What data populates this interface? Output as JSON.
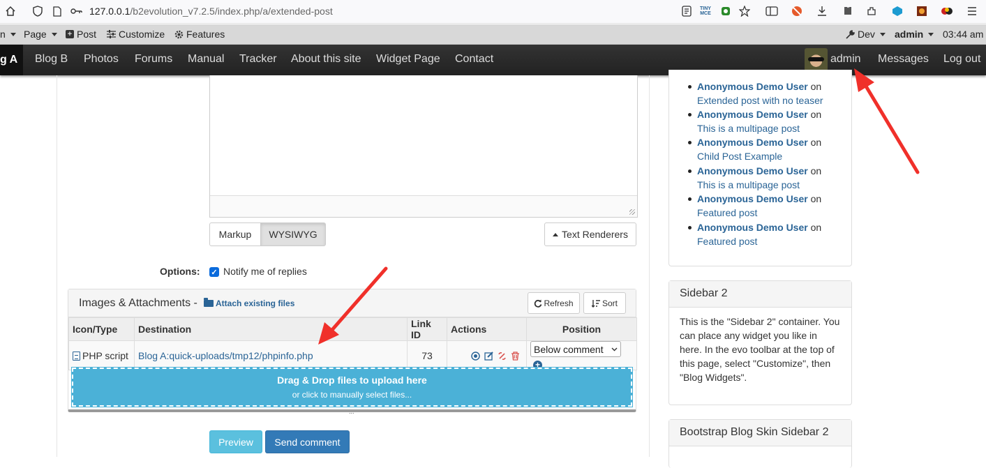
{
  "browser": {
    "url_host": "127.0.0.1",
    "url_path": "/b2evolution_v7.2.5/index.php/a/extended-post",
    "tinymce_label": "TINY MCE"
  },
  "evo_toolbar": {
    "menu_partial": "n",
    "page": "Page",
    "post": "Post",
    "customize": "Customize",
    "features": "Features",
    "dev": "Dev",
    "user": "admin",
    "time": "03:44 am"
  },
  "site_nav": {
    "active": "g A",
    "items": [
      "Blog B",
      "Photos",
      "Forums",
      "Manual",
      "Tracker",
      "About this site",
      "Widget Page",
      "Contact"
    ],
    "user": "admin",
    "messages": "Messages",
    "logout": "Log out"
  },
  "editor": {
    "markup_label": "Markup",
    "wysiwyg_label": "WYSIWYG",
    "text_renderers_label": "Text Renderers"
  },
  "options": {
    "label": "Options:",
    "notify_label": "Notify me of replies",
    "notify_checked": true
  },
  "attachments": {
    "title": "Images & Attachments -",
    "attach_existing_label": "Attach existing files",
    "refresh_label": "Refresh",
    "sort_label": "Sort",
    "columns": [
      "Icon/Type",
      "Destination",
      "Link ID",
      "Actions",
      "Position"
    ],
    "rows": [
      {
        "type": "PHP script",
        "destination": "Blog A:quick-uploads/tmp12/phpinfo.php",
        "link_id": "73",
        "position": "Below comment"
      }
    ],
    "dropzone_main": "Drag & Drop files to upload here",
    "dropzone_sub": "or click to manually select files...",
    "handle": "..."
  },
  "actions": {
    "preview_label": "Preview",
    "send_label": "Send comment"
  },
  "sidebar": {
    "comments": [
      {
        "author": "Anonymous Demo User",
        "on": "on",
        "post": "Extended post with no teaser"
      },
      {
        "author": "Anonymous Demo User",
        "on": "on",
        "post": "This is a multipage post"
      },
      {
        "author": "Anonymous Demo User",
        "on": "on",
        "post": "Child Post Example"
      },
      {
        "author": "Anonymous Demo User",
        "on": "on",
        "post": "This is a multipage post"
      },
      {
        "author": "Anonymous Demo User",
        "on": "on",
        "post": "Featured post"
      },
      {
        "author": "Anonymous Demo User",
        "on": "on",
        "post": "Featured post"
      }
    ],
    "sidebar2_title": "Sidebar 2",
    "sidebar2_body": "This is the \"Sidebar 2\" container. You can place any widget you like in here. In the evo toolbar at the top of this page, select \"Customize\", then \"Blog Widgets\".",
    "bootstrap_title": "Bootstrap Blog Skin Sidebar 2"
  },
  "colors": {
    "link": "#2a6496",
    "dropzone": "#4bb1d7",
    "preview_btn": "#5bc0de",
    "send_btn": "#337ab7",
    "annotation_arrow": "#f0302a"
  }
}
